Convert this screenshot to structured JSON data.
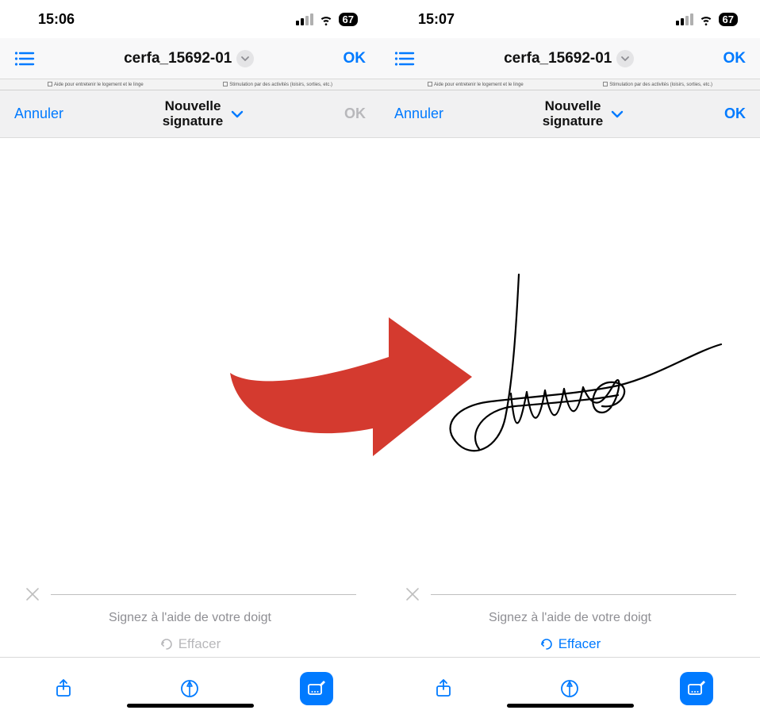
{
  "screens": [
    {
      "status": {
        "time": "15:06",
        "battery": "67"
      },
      "navbar": {
        "title": "cerfa_15692-01",
        "ok": "OK"
      },
      "doc_peek": {
        "left": "Aide pour entretenir le logement et le linge",
        "right": "Stimulation par des activités (loisirs, sorties, etc.)"
      },
      "sig_toolbar": {
        "cancel": "Annuler",
        "title": "Nouvelle\nsignature",
        "ok": "OK",
        "ok_enabled": false
      },
      "sig_hint": "Signez à l'aide de votre doigt",
      "erase": {
        "label": "Effacer",
        "enabled": false
      },
      "has_signature": false
    },
    {
      "status": {
        "time": "15:07",
        "battery": "67"
      },
      "navbar": {
        "title": "cerfa_15692-01",
        "ok": "OK"
      },
      "doc_peek": {
        "left": "Aide pour entretenir le logement et le linge",
        "right": "Stimulation par des activités (loisirs, sorties, etc.)"
      },
      "sig_toolbar": {
        "cancel": "Annuler",
        "title": "Nouvelle\nsignature",
        "ok": "OK",
        "ok_enabled": true
      },
      "sig_hint": "Signez à l'aide de votre doigt",
      "erase": {
        "label": "Effacer",
        "enabled": true
      },
      "has_signature": true
    }
  ],
  "colors": {
    "accent": "#007aff",
    "arrow": "#d43a2f"
  }
}
